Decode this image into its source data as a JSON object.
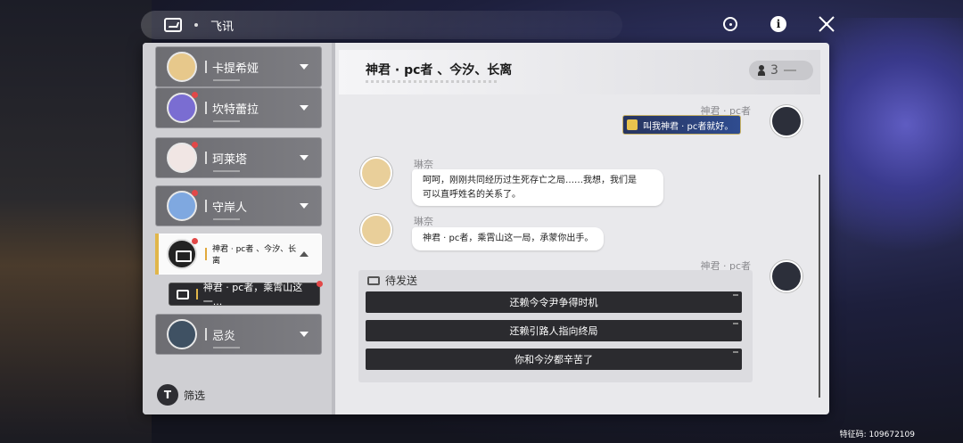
{
  "app": {
    "title": "飞讯"
  },
  "top_icons": [
    "target-icon",
    "info-icon",
    "close-icon"
  ],
  "sidebar": {
    "contacts": [
      {
        "name": "卡提希娅",
        "badge": false,
        "avatar_color": "#e7c88b"
      },
      {
        "name": "坎特蕾拉",
        "badge": true,
        "avatar_color": "#7a6dd2"
      },
      {
        "name": "珂莱塔",
        "badge": true,
        "avatar_color": "#f1e6e4"
      },
      {
        "name": "守岸人",
        "badge": true,
        "avatar_color": "#7fa8e0"
      },
      {
        "name": "神君 · pc者 、今汐、长离",
        "badge": true,
        "active": true
      },
      {
        "name": "忌炎",
        "badge": false,
        "avatar_color": "#3f5163"
      }
    ],
    "sub_thread": {
      "text": "神君 · pc者，乘霄山这一...",
      "badge": true
    },
    "filter": {
      "icon_letter": "T",
      "label": "筛选"
    }
  },
  "chat": {
    "title": "神君 · pc者 、今汐、长离",
    "member_count": "3",
    "messages": [
      {
        "sender": "神君 · pc者",
        "side": "right",
        "text": "叫我神君 · pc者就好。",
        "sticker": true
      },
      {
        "sender": "琳奈",
        "side": "left",
        "text_line1": "呵呵，刚刚共同经历过生死存亡之局……我想，我们是",
        "text_line2": "可以直呼姓名的关系了。"
      },
      {
        "sender": "琳奈",
        "side": "left",
        "text": "神君 · pc者，乘霄山这一局，承蒙你出手。"
      },
      {
        "sender": "神君 · pc者",
        "side": "right"
      }
    ],
    "pending": {
      "label": "待发送",
      "choices": [
        "还赖今令尹争得时机",
        "还赖引路人指向终局",
        "你和今汐都辛苦了"
      ]
    }
  },
  "footer": {
    "code": "特征码: 109672109"
  },
  "colors": {
    "badge": "#e24848",
    "accent": "#e1b64a"
  }
}
